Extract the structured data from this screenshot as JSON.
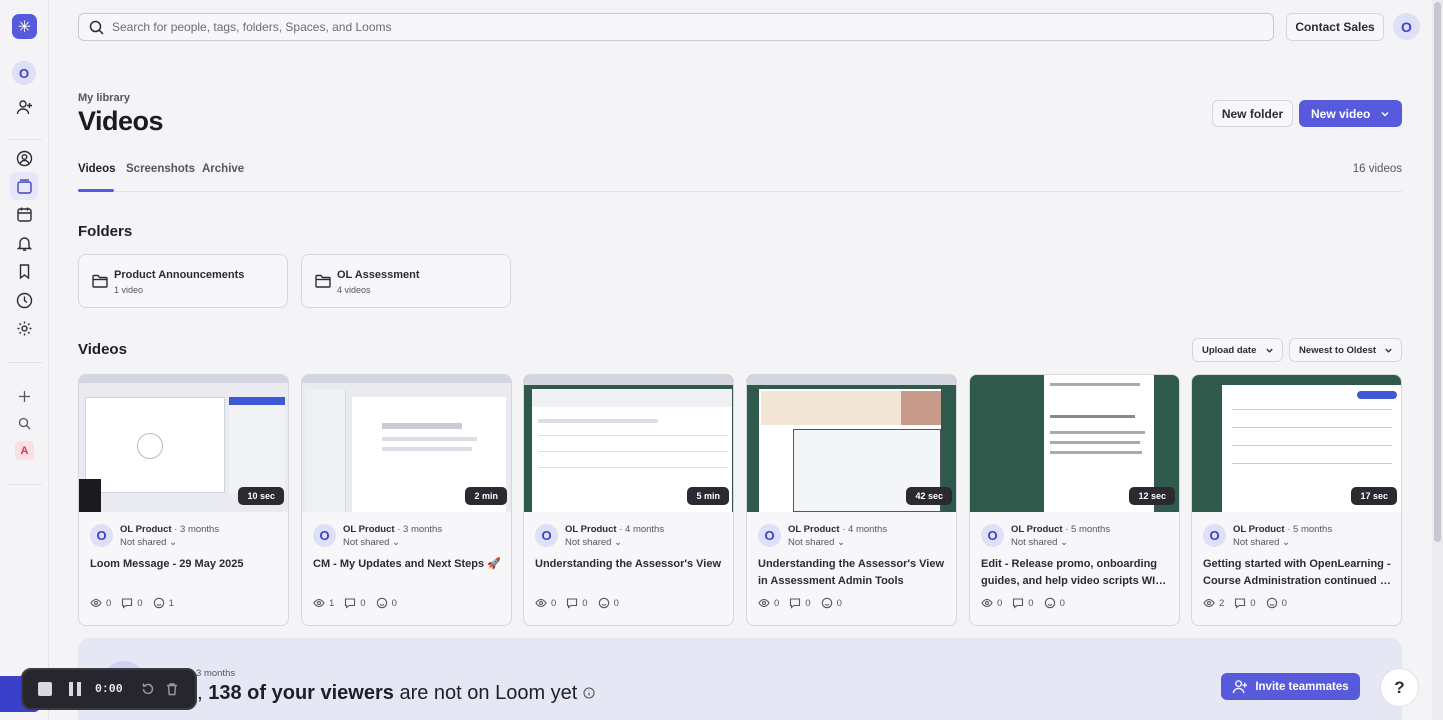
{
  "search": {
    "placeholder": "Search for people, tags, folders, Spaces, and Looms"
  },
  "header": {
    "contact_sales": "Contact Sales",
    "avatar_initial": "O"
  },
  "rail": {
    "avatar_initial": "O",
    "workspace_badge": "A"
  },
  "page": {
    "breadcrumb": "My library",
    "title": "Videos",
    "new_folder": "New folder",
    "new_video": "New video"
  },
  "tabs": [
    {
      "label": "Videos",
      "active": true
    },
    {
      "label": "Screenshots",
      "active": false
    },
    {
      "label": "Archive",
      "active": false
    }
  ],
  "video_count": "16 videos",
  "folders_heading": "Folders",
  "folders": [
    {
      "name": "Product Announcements",
      "count": "1 video"
    },
    {
      "name": "OL Assessment",
      "count": "4 videos"
    }
  ],
  "videos_heading": "Videos",
  "sort": {
    "field": "Upload date",
    "order": "Newest to Oldest"
  },
  "videos": [
    {
      "title": "Loom Message - 29 May 2025",
      "duration": "10 sec",
      "author": "OL Product",
      "age": "3 months",
      "shared": "Not shared",
      "views": "0",
      "comments": "0",
      "reactions": "1"
    },
    {
      "title": "CM - My Updates and Next Steps 🚀",
      "duration": "2 min",
      "author": "OL Product",
      "age": "3 months",
      "shared": "Not shared",
      "views": "1",
      "comments": "0",
      "reactions": "0"
    },
    {
      "title": "Understanding the Assessor's View",
      "duration": "5 min",
      "author": "OL Product",
      "age": "4 months",
      "shared": "Not shared",
      "views": "0",
      "comments": "0",
      "reactions": "0"
    },
    {
      "title": "Understanding the Assessor's View in Assessment Admin Tools",
      "duration": "42 sec",
      "author": "OL Product",
      "age": "4 months",
      "shared": "Not shared",
      "views": "0",
      "comments": "0",
      "reactions": "0"
    },
    {
      "title": "Edit - Release promo, onboarding guides, and help video scripts WI…",
      "duration": "12 sec",
      "author": "OL Product",
      "age": "5 months",
      "shared": "Not shared",
      "views": "0",
      "comments": "0",
      "reactions": "0"
    },
    {
      "title": "Getting started with OpenLearning - Course Administration continued …",
      "duration": "17 sec",
      "author": "OL Product",
      "age": "5 months",
      "shared": "Not shared",
      "views": "2",
      "comments": "0",
      "reactions": "0"
    }
  ],
  "insight": {
    "meta": "st 3 months",
    "prefix": "o, ",
    "highlight": "138 of your viewers",
    "suffix": " are not on Loom yet"
  },
  "invite_label": "Invite teammates",
  "help_label": "?",
  "recorder": {
    "time": "0:00"
  },
  "colors": {
    "accent": "#565adb",
    "background": "#f4f4f6"
  }
}
